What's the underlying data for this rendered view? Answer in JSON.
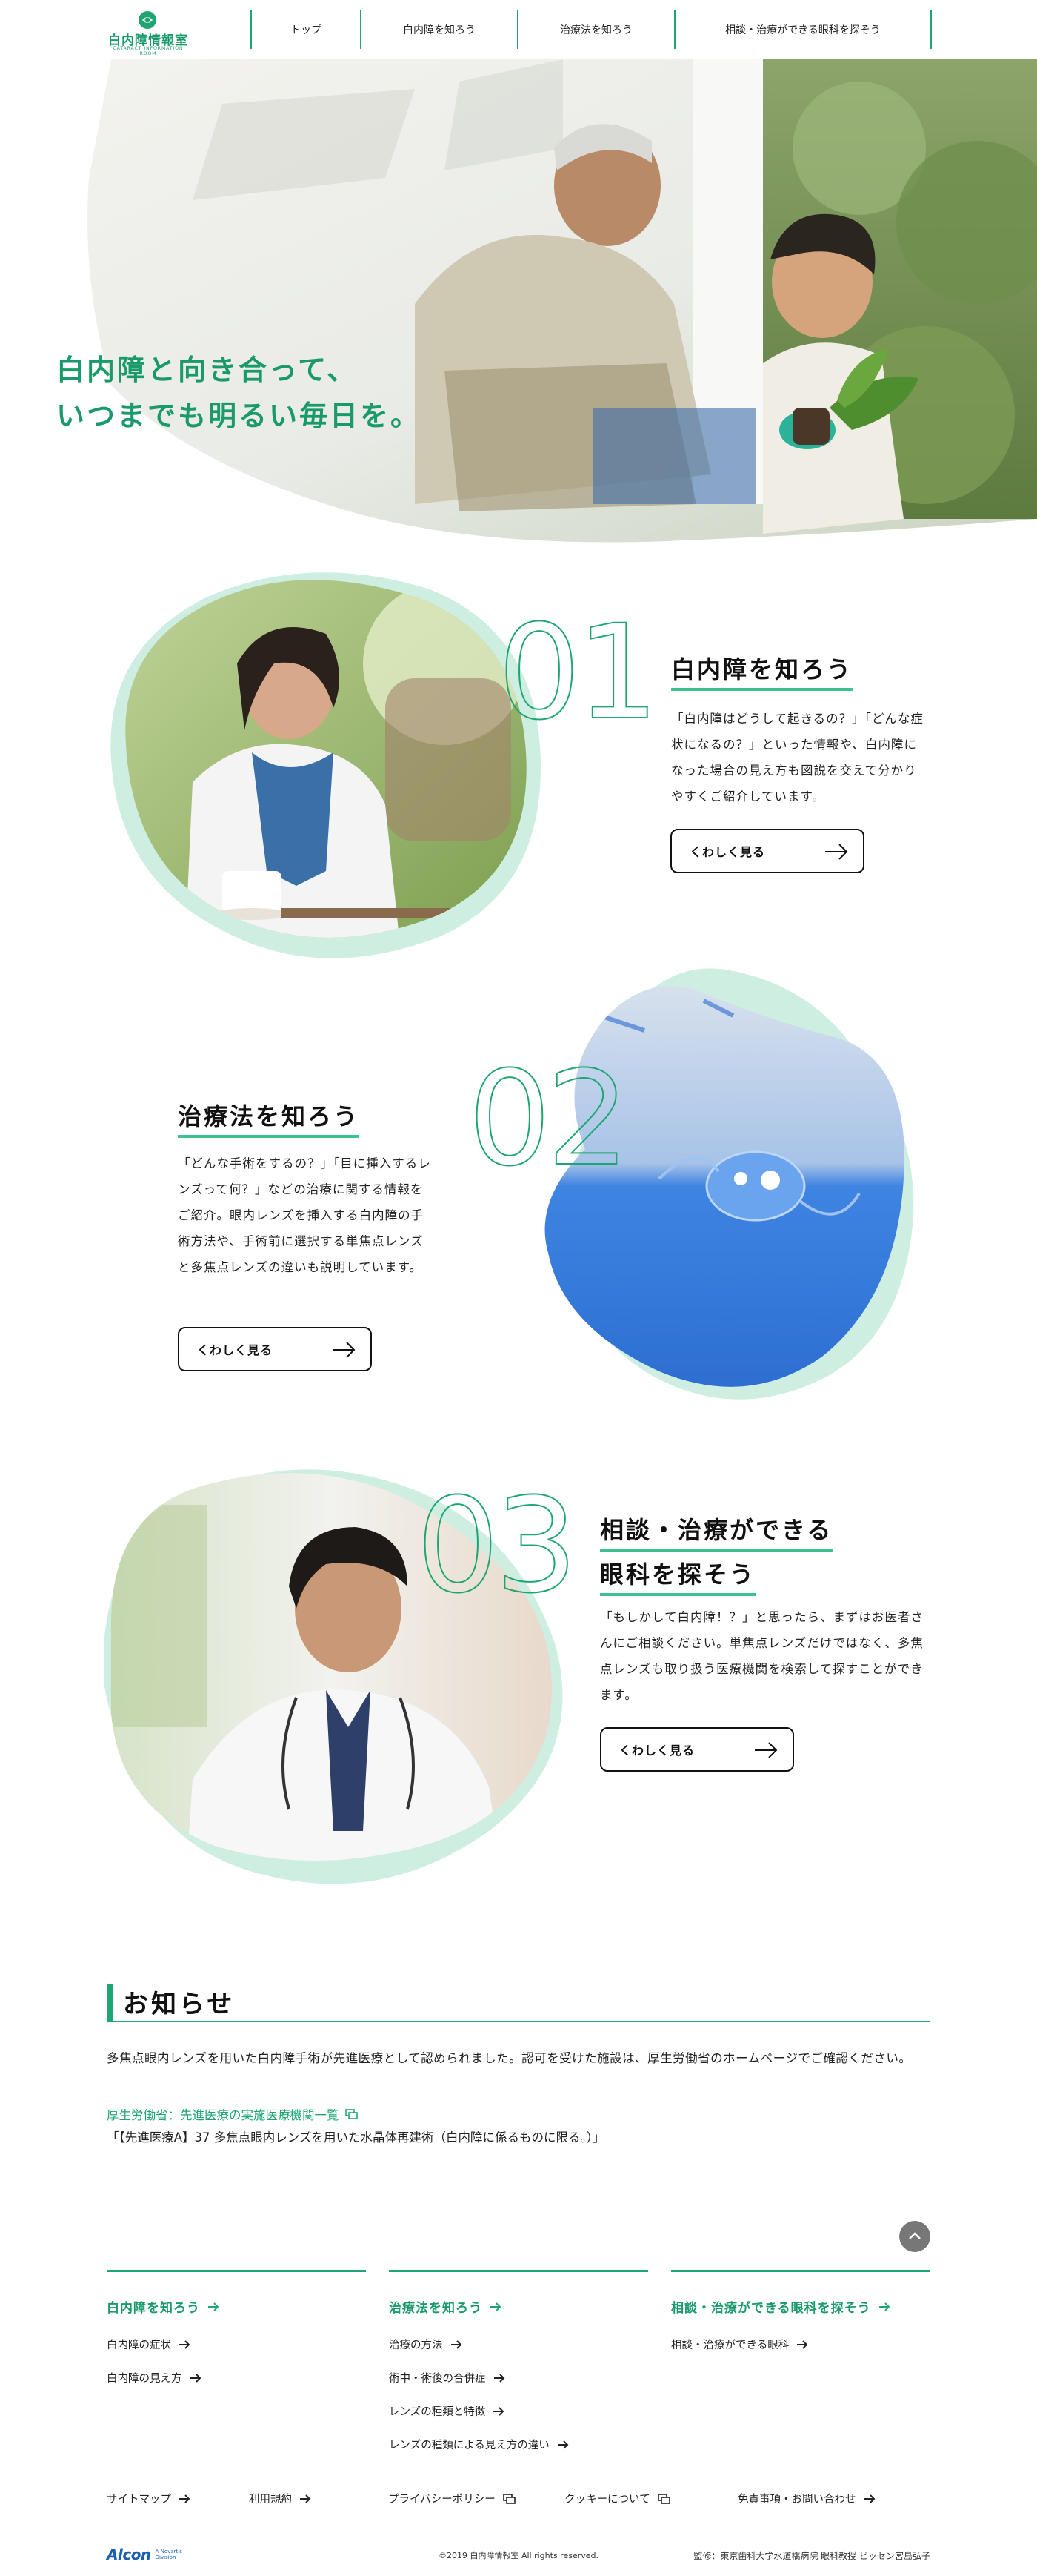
{
  "header": {
    "logo_text": "白内障情報室",
    "logo_sub": "CATARACT INFORMATION ROOM",
    "nav": [
      {
        "label": "トップ"
      },
      {
        "label": "白内障を知ろう"
      },
      {
        "label": "治療法を知ろう"
      },
      {
        "label": "相談・治療ができる眼科を探そう"
      }
    ]
  },
  "hero": {
    "copy_line1": "白内障と向き合って、",
    "copy_line2": "いつまでも明るい毎日を。"
  },
  "sections": [
    {
      "number": "01",
      "title_line1": "白内障を知ろう",
      "text": "「白内障はどうして起きるの？」「どんな症状になるの？」といった情報や、白内障になった場合の見え方も図説を交えて分かりやすくご紹介しています。",
      "button": "くわしく見る"
    },
    {
      "number": "02",
      "title_line1": "治療法を知ろう",
      "text": "「どんな手術をするの？」「目に挿入するレンズって何？」などの治療に関する情報をご紹介。眼内レンズを挿入する白内障の手術方法や、手術前に選択する単焦点レンズと多焦点レンズの違いも説明しています。",
      "button": "くわしく見る"
    },
    {
      "number": "03",
      "title_line1": "相談・治療ができる",
      "title_line2": "眼科を探そう",
      "text": "「もしかして白内障！？」と思ったら、まずはお医者さんにご相談ください。単焦点レンズだけではなく、多焦点レンズも取り扱う医療機関を検索して探すことができます。",
      "button": "くわしく見る"
    }
  ],
  "news": {
    "title": "お知らせ",
    "text": "多焦点眼内レンズを用いた白内障手術が先進医療として認められました。認可を受けた施設は、厚生労働省のホームページでご確認ください。",
    "link": "厚生労働省：先進医療の実施医療機関一覧",
    "note": "「【先進医療A】37 多焦点眼内レンズを用いた水晶体再建術（白内障に係るものに限る。）」"
  },
  "footer_nav": [
    {
      "heading": "白内障を知ろう",
      "items": [
        "白内障の症状",
        "白内障の見え方"
      ]
    },
    {
      "heading": "治療法を知ろう",
      "items": [
        "治療の方法",
        "術中・術後の合併症",
        "レンズの種類と特徴",
        "レンズの種類による見え方の違い"
      ]
    },
    {
      "heading": "相談・治療ができる眼科を探そう",
      "items": [
        "相談・治療ができる眼科"
      ]
    }
  ],
  "utility_links": [
    {
      "label": "サイトマップ",
      "icon": "arrow-right-icon"
    },
    {
      "label": "利用規約",
      "icon": "arrow-right-icon"
    },
    {
      "label": "プライバシーポリシー",
      "icon": "external-window-icon"
    },
    {
      "label": "クッキーについて",
      "icon": "external-window-icon"
    },
    {
      "label": "免責事項・お問い合わせ",
      "icon": "arrow-right-icon"
    }
  ],
  "copybar": {
    "alcon": "Alcon",
    "alcon_sub": "A Novartis Division",
    "copyright": "©2019 白内障情報室 All rights reserved.",
    "supervision": "監修：東京歯科大学水道橋病院 眼科教授 ビッセン宮島弘子"
  },
  "colors": {
    "accent": "#1ea672",
    "accent_text": "#1a9a6a",
    "mint_blob": "#cdeee0",
    "alcon_blue": "#1a5fb0"
  }
}
